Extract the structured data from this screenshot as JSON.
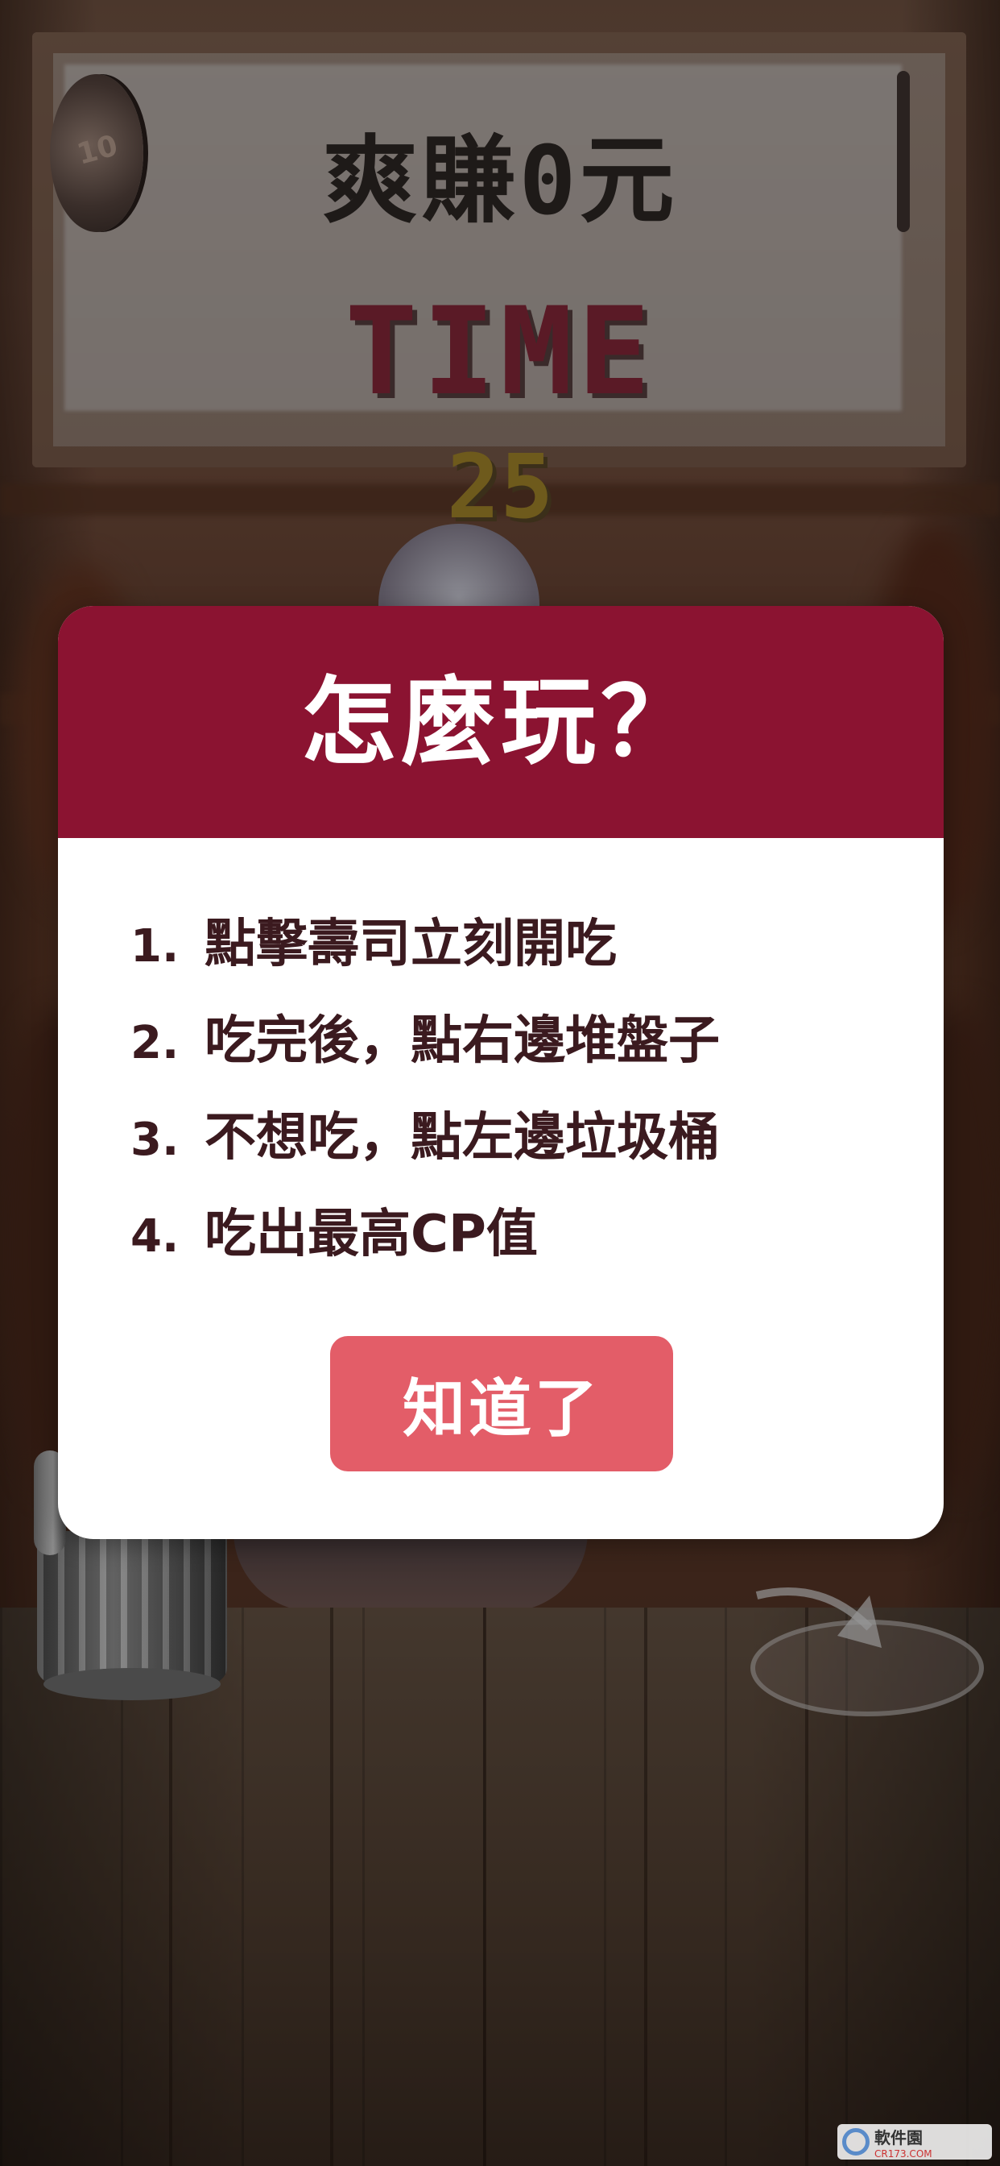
{
  "hud": {
    "earnings_text": "爽賺0元",
    "time_label": "TIME",
    "time_value": "25",
    "coin_label": "10",
    "coin_icon": "coin-icon",
    "plate_icon": "plate-edge-icon"
  },
  "dialog": {
    "title": "怎麼玩？",
    "rules": [
      {
        "num": "1.",
        "text": "點擊壽司立刻開吃"
      },
      {
        "num": "2.",
        "text": "吃完後，點右邊堆盤子"
      },
      {
        "num": "3.",
        "text": "不想吃，點左邊垃圾桶"
      },
      {
        "num": "4.",
        "text": "吃出最高CP值"
      }
    ],
    "ok_button": "知道了",
    "header_color": "#8b1331",
    "button_color": "#e35d68"
  },
  "props": {
    "trash_icon": "trash-can-icon",
    "stack_icon": "plate-stack-target-icon"
  },
  "watermark": {
    "text": "軟件園",
    "sub": "CR173.COM"
  }
}
